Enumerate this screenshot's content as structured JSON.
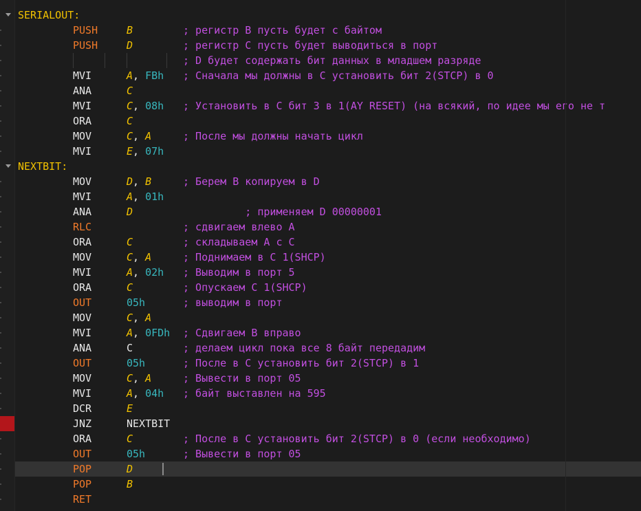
{
  "colors": {
    "background": "#1c1c1c",
    "label": "#f2c200",
    "mnemonic": "#e8e8e8",
    "flow_mnemonic": "#f07a2a",
    "register": "#f2c200",
    "number": "#38b7be",
    "comment": "#c24fe0",
    "error_marker": "#b3161b",
    "current_line": "#333333"
  },
  "icons": {
    "fold": "chevron-down-icon",
    "error": "breakpoint-error-marker"
  },
  "code": [
    {
      "label": "SERIALOUT:"
    },
    {
      "mn": "PUSH",
      "flow": true,
      "ops": [
        {
          "t": "B",
          "k": "reg"
        }
      ],
      "comment": "; регистр B пусть будет с байтом"
    },
    {
      "mn": "PUSH",
      "flow": true,
      "ops": [
        {
          "t": "D",
          "k": "reg"
        }
      ],
      "comment": "; регистр C пусть будет выводиться в порт"
    },
    {
      "guides": true,
      "comment": "; D будет содержать бит данных в младшем разряде"
    },
    {
      "mn": "MVI",
      "ops": [
        {
          "t": "A",
          "k": "reg"
        },
        {
          "t": ", ",
          "k": "punct"
        },
        {
          "t": "FBh",
          "k": "num"
        }
      ],
      "comment": "; Сначала мы должны в C установить бит 2(STCP) в 0"
    },
    {
      "mn": "ANA",
      "ops": [
        {
          "t": "C",
          "k": "reg"
        }
      ]
    },
    {
      "mn": "MVI",
      "ops": [
        {
          "t": "C",
          "k": "reg"
        },
        {
          "t": ", ",
          "k": "punct"
        },
        {
          "t": "08h",
          "k": "num"
        }
      ],
      "comment": "; Установить в C бит 3 в 1(AY RESET) (на всякий, по идее мы его не т"
    },
    {
      "mn": "ORA",
      "ops": [
        {
          "t": "C",
          "k": "reg"
        }
      ]
    },
    {
      "mn": "MOV",
      "ops": [
        {
          "t": "C",
          "k": "reg"
        },
        {
          "t": ", ",
          "k": "punct"
        },
        {
          "t": "A",
          "k": "reg"
        }
      ],
      "comment": "; После мы должны начать цикл"
    },
    {
      "mn": "MVI",
      "ops": [
        {
          "t": "E",
          "k": "reg"
        },
        {
          "t": ", ",
          "k": "punct"
        },
        {
          "t": "07h",
          "k": "num"
        }
      ]
    },
    {
      "label": "NEXTBIT:"
    },
    {
      "mn": "MOV",
      "ops": [
        {
          "t": "D",
          "k": "reg"
        },
        {
          "t": ", ",
          "k": "punct"
        },
        {
          "t": "B",
          "k": "reg"
        }
      ],
      "comment": "; Берем B копируем в D"
    },
    {
      "mn": "MVI",
      "ops": [
        {
          "t": "A",
          "k": "reg"
        },
        {
          "t": ", ",
          "k": "punct"
        },
        {
          "t": "01h",
          "k": "num"
        }
      ]
    },
    {
      "mn": "ANA",
      "ops": [
        {
          "t": "D",
          "k": "reg"
        }
      ],
      "comment": "          ; применяем D 00000001"
    },
    {
      "mn": "RLC",
      "flow": true,
      "comment": "; сдвигаем влево A"
    },
    {
      "mn": "ORA",
      "ops": [
        {
          "t": "C",
          "k": "reg"
        }
      ],
      "comment": "; складываем A с C"
    },
    {
      "mn": "MOV",
      "ops": [
        {
          "t": "C",
          "k": "reg"
        },
        {
          "t": ", ",
          "k": "punct"
        },
        {
          "t": "A",
          "k": "reg"
        }
      ],
      "comment": "; Поднимаем в C 1(SHCP)"
    },
    {
      "mn": "MVI",
      "ops": [
        {
          "t": "A",
          "k": "reg"
        },
        {
          "t": ", ",
          "k": "punct"
        },
        {
          "t": "02h",
          "k": "num"
        }
      ],
      "comment": "; Выводим в порт 5"
    },
    {
      "mn": "ORA",
      "ops": [
        {
          "t": "C",
          "k": "reg"
        }
      ],
      "comment": "; Опускаем C 1(SHCP)"
    },
    {
      "mn": "OUT",
      "flow": true,
      "ops": [
        {
          "t": "05h",
          "k": "num"
        }
      ],
      "comment": "; выводим в порт"
    },
    {
      "mn": "MOV",
      "ops": [
        {
          "t": "C",
          "k": "reg"
        },
        {
          "t": ", ",
          "k": "punct"
        },
        {
          "t": "A",
          "k": "reg"
        }
      ]
    },
    {
      "mn": "MVI",
      "ops": [
        {
          "t": "A",
          "k": "reg"
        },
        {
          "t": ", ",
          "k": "punct"
        },
        {
          "t": "0FDh",
          "k": "num"
        }
      ],
      "comment": "; Сдвигаем B вправо"
    },
    {
      "mn": "ANA",
      "ops": [
        {
          "t": "C",
          "k": "plain"
        }
      ],
      "comment": "; делаем цикл пока все 8 байт передадим"
    },
    {
      "mn": "OUT",
      "flow": true,
      "ops": [
        {
          "t": "05h",
          "k": "num"
        }
      ],
      "comment": "; После в C установить бит 2(STCP) в 1"
    },
    {
      "mn": "MOV",
      "ops": [
        {
          "t": "C",
          "k": "reg"
        },
        {
          "t": ", ",
          "k": "punct"
        },
        {
          "t": "A",
          "k": "reg"
        }
      ],
      "comment": "; Вывести в порт 05"
    },
    {
      "mn": "MVI",
      "ops": [
        {
          "t": "A",
          "k": "reg"
        },
        {
          "t": ", ",
          "k": "punct"
        },
        {
          "t": "04h",
          "k": "num"
        }
      ],
      "comment": "; байт выставлен на 595"
    },
    {
      "mn": "DCR",
      "ops": [
        {
          "t": "E",
          "k": "reg"
        }
      ]
    },
    {
      "mn": "JNZ",
      "ops": [
        {
          "t": "NEXTBIT",
          "k": "plain"
        }
      ],
      "error": true
    },
    {
      "mn": "ORA",
      "ops": [
        {
          "t": "C",
          "k": "reg"
        }
      ],
      "comment": "; После в C установить бит 2(STCP) в 0 (если необходимо)"
    },
    {
      "mn": "OUT",
      "flow": true,
      "ops": [
        {
          "t": "05h",
          "k": "num"
        }
      ],
      "comment": "; Вывести в порт 05"
    },
    {
      "mn": "POP",
      "flow": true,
      "ops": [
        {
          "t": "D",
          "k": "reg"
        }
      ],
      "current": true
    },
    {
      "mn": "POP",
      "flow": true,
      "ops": [
        {
          "t": "B",
          "k": "reg"
        }
      ]
    },
    {
      "mn": "RET",
      "flow": true
    }
  ]
}
